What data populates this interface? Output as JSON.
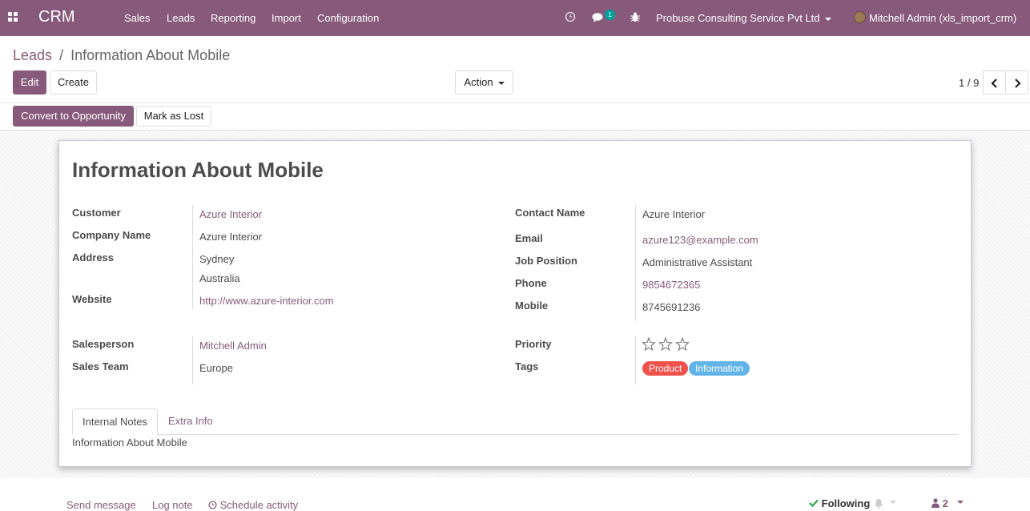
{
  "navbar": {
    "brand": "CRM",
    "menu": [
      "Sales",
      "Leads",
      "Reporting",
      "Import",
      "Configuration"
    ],
    "message_count": "1",
    "company": "Probuse Consulting Service Pvt Ltd",
    "user": "Mitchell Admin (xls_import_crm)",
    "icons": [
      "apps-icon",
      "clock-icon",
      "chat-icon",
      "bug-icon"
    ]
  },
  "breadcrumb": {
    "parent": "Leads",
    "separator": "/",
    "current": "Information About Mobile"
  },
  "controls": {
    "edit": "Edit",
    "create": "Create",
    "action": "Action",
    "pager": "1 / 9"
  },
  "statusbar": {
    "convert": "Convert to Opportunity",
    "lost": "Mark as Lost"
  },
  "form": {
    "title": "Information About Mobile",
    "left": {
      "customer_label": "Customer",
      "customer": "Azure Interior",
      "company_label": "Company Name",
      "company": "Azure Interior",
      "address_label": "Address",
      "address_line1": "Sydney",
      "address_line2": "Australia",
      "website_label": "Website",
      "website": "http://www.azure-interior.com",
      "salesperson_label": "Salesperson",
      "salesperson": "Mitchell Admin",
      "team_label": "Sales Team",
      "team": "Europe"
    },
    "right": {
      "contact_label": "Contact Name",
      "contact": "Azure Interior",
      "email_label": "Email",
      "email": "azure123@example.com",
      "job_label": "Job Position",
      "job": "Administrative Assistant",
      "phone_label": "Phone",
      "phone": "9854672365",
      "mobile_label": "Mobile",
      "mobile": "8745691236",
      "priority_label": "Priority",
      "priority_value": 0,
      "priority_max": 3,
      "tags_label": "Tags",
      "tags": [
        {
          "label": "Product",
          "color": "#f0524b"
        },
        {
          "label": "Information",
          "color": "#62b4e8"
        }
      ]
    },
    "tabs": {
      "notes": "Internal Notes",
      "extra": "Extra Info"
    },
    "notes_text": "Information About Mobile"
  },
  "chatter": {
    "send": "Send message",
    "log": "Log note",
    "schedule": "Schedule activity",
    "following": "Following",
    "followers": "2"
  },
  "colors": {
    "brand": "#875a7b",
    "badge": "#00a09d",
    "check": "#28a745"
  }
}
